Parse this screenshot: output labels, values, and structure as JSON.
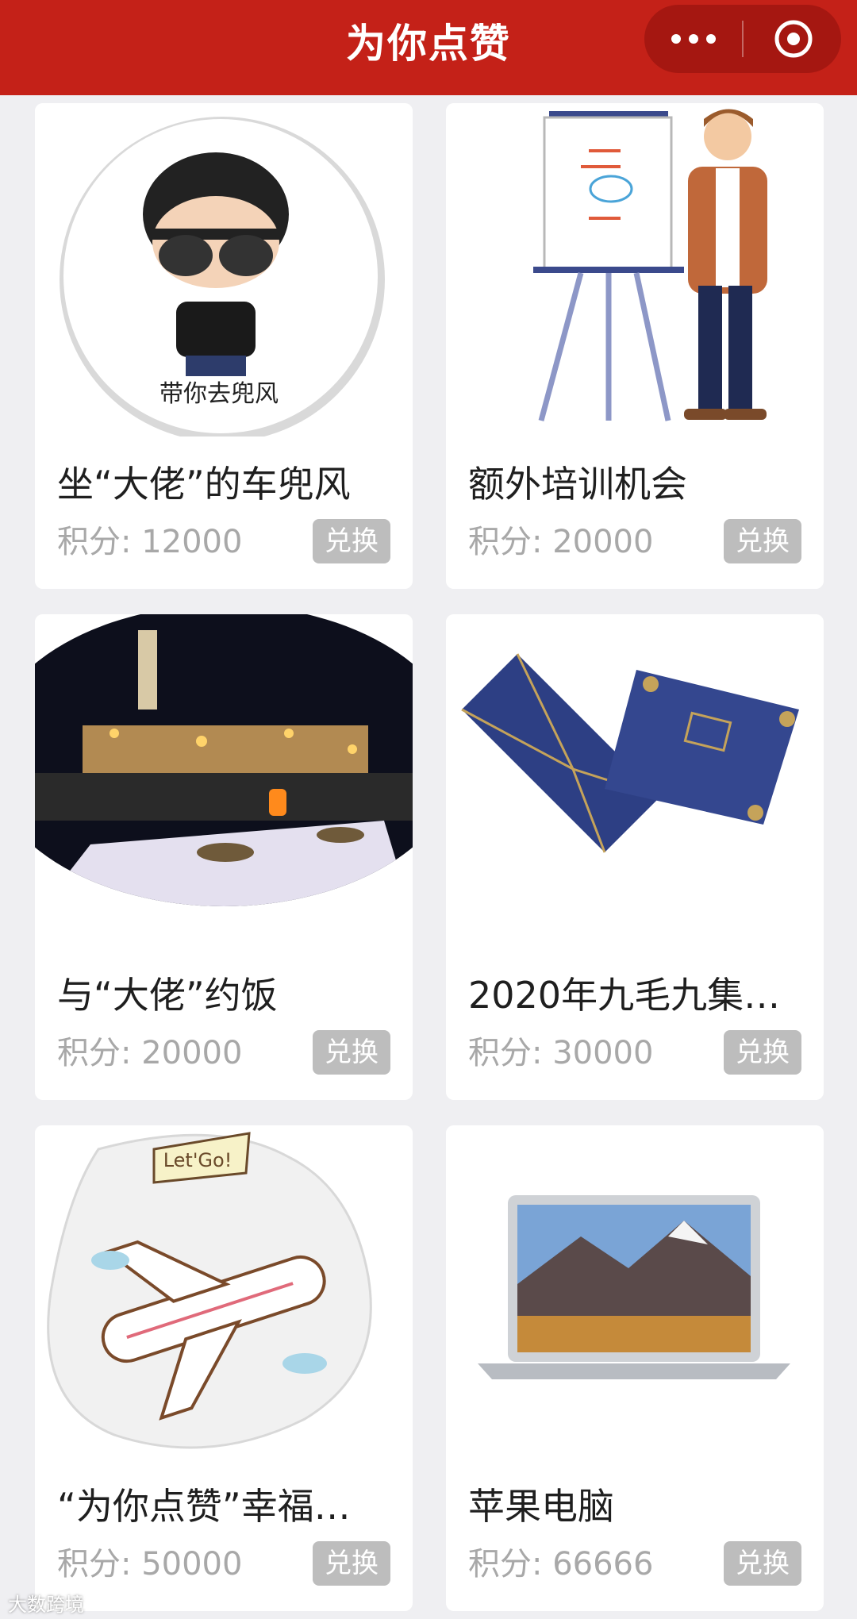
{
  "header": {
    "title": "为你点赞"
  },
  "capsule": {
    "more_icon": "more-dots-icon",
    "close_icon": "target-close-icon"
  },
  "products": [
    {
      "name": "坐“大佬”的车兜风",
      "points_label": "积分: 12000",
      "button": "兑换",
      "image": "cartoon-avatar-image",
      "image_text": "带你去兜风"
    },
    {
      "name": "额外培训机会",
      "points_label": "积分: 20000",
      "button": "兑换",
      "image": "trainer-whiteboard-image"
    },
    {
      "name": "与“大佬”约饭",
      "points_label": "积分: 20000",
      "button": "兑换",
      "image": "dinner-night-view-image"
    },
    {
      "name": "2020年九毛九集…",
      "points_label": "积分: 30000",
      "button": "兑换",
      "image": "invitation-envelope-image"
    },
    {
      "name": "“为你点赞”幸福…",
      "points_label": "积分: 50000",
      "button": "兑换",
      "image": "airplane-letsgo-image",
      "image_text": "Let'Go!"
    },
    {
      "name": "苹果电脑",
      "points_label": "积分: 66666",
      "button": "兑换",
      "image": "laptop-image"
    }
  ],
  "watermark": "大数跨境",
  "colors": {
    "brand_red": "#c42118",
    "button_gray": "#bdbdbd",
    "background": "#efeff2"
  }
}
